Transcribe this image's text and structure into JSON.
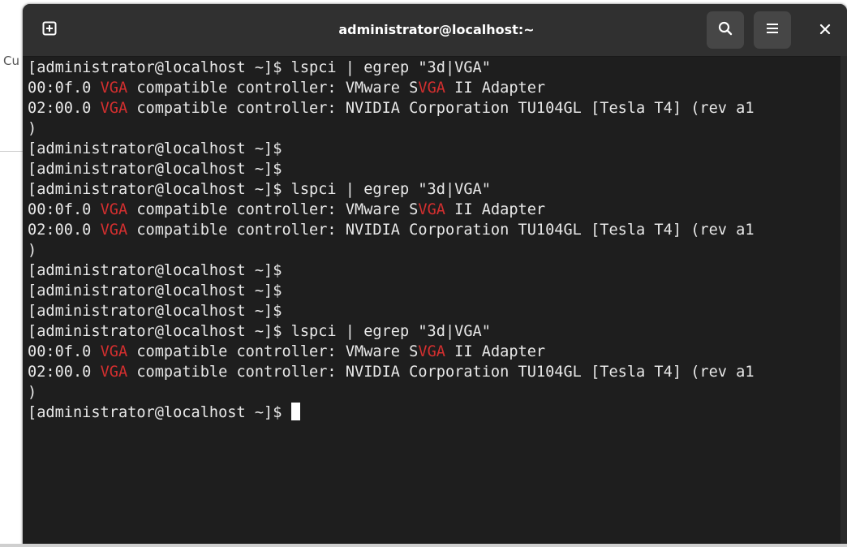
{
  "background": {
    "partial_text": "Cu"
  },
  "window": {
    "title": "administrator@localhost:~",
    "buttons": {
      "new_tab_icon": "new-tab-icon",
      "search_icon": "search-icon",
      "menu_icon": "hamburger-menu-icon",
      "close_icon": "close-icon"
    }
  },
  "colors": {
    "terminal_bg": "#1e1e1e",
    "titlebar_bg": "#303030",
    "text": "#e8e8e8",
    "highlight": "#d32f2f"
  },
  "terminal": {
    "lines": [
      {
        "segments": [
          {
            "t": "[administrator@localhost ~]$ lspci | egrep \"3d|VGA\"",
            "hl": false
          }
        ]
      },
      {
        "segments": [
          {
            "t": "00:0f.0 ",
            "hl": false
          },
          {
            "t": "VGA",
            "hl": true
          },
          {
            "t": " compatible controller: VMware S",
            "hl": false
          },
          {
            "t": "VGA",
            "hl": true
          },
          {
            "t": " II Adapter",
            "hl": false
          }
        ]
      },
      {
        "segments": [
          {
            "t": "02:00.0 ",
            "hl": false
          },
          {
            "t": "VGA",
            "hl": true
          },
          {
            "t": " compatible controller: NVIDIA Corporation TU104GL [Tesla T4] (rev a1",
            "hl": false
          }
        ]
      },
      {
        "segments": [
          {
            "t": ")",
            "hl": false
          }
        ]
      },
      {
        "segments": [
          {
            "t": "[administrator@localhost ~]$",
            "hl": false
          }
        ]
      },
      {
        "segments": [
          {
            "t": "[administrator@localhost ~]$",
            "hl": false
          }
        ]
      },
      {
        "segments": [
          {
            "t": "[administrator@localhost ~]$ lspci | egrep \"3d|VGA\"",
            "hl": false
          }
        ]
      },
      {
        "segments": [
          {
            "t": "00:0f.0 ",
            "hl": false
          },
          {
            "t": "VGA",
            "hl": true
          },
          {
            "t": " compatible controller: VMware S",
            "hl": false
          },
          {
            "t": "VGA",
            "hl": true
          },
          {
            "t": " II Adapter",
            "hl": false
          }
        ]
      },
      {
        "segments": [
          {
            "t": "02:00.0 ",
            "hl": false
          },
          {
            "t": "VGA",
            "hl": true
          },
          {
            "t": " compatible controller: NVIDIA Corporation TU104GL [Tesla T4] (rev a1",
            "hl": false
          }
        ]
      },
      {
        "segments": [
          {
            "t": ")",
            "hl": false
          }
        ]
      },
      {
        "segments": [
          {
            "t": "[administrator@localhost ~]$",
            "hl": false
          }
        ]
      },
      {
        "segments": [
          {
            "t": "[administrator@localhost ~]$",
            "hl": false
          }
        ]
      },
      {
        "segments": [
          {
            "t": "[administrator@localhost ~]$",
            "hl": false
          }
        ]
      },
      {
        "segments": [
          {
            "t": "[administrator@localhost ~]$ lspci | egrep \"3d|VGA\"",
            "hl": false
          }
        ]
      },
      {
        "segments": [
          {
            "t": "00:0f.0 ",
            "hl": false
          },
          {
            "t": "VGA",
            "hl": true
          },
          {
            "t": " compatible controller: VMware S",
            "hl": false
          },
          {
            "t": "VGA",
            "hl": true
          },
          {
            "t": " II Adapter",
            "hl": false
          }
        ]
      },
      {
        "segments": [
          {
            "t": "02:00.0 ",
            "hl": false
          },
          {
            "t": "VGA",
            "hl": true
          },
          {
            "t": " compatible controller: NVIDIA Corporation TU104GL [Tesla T4] (rev a1",
            "hl": false
          }
        ]
      },
      {
        "segments": [
          {
            "t": ")",
            "hl": false
          }
        ]
      },
      {
        "segments": [
          {
            "t": "[administrator@localhost ~]$ ",
            "hl": false
          }
        ],
        "cursor": true
      }
    ]
  }
}
